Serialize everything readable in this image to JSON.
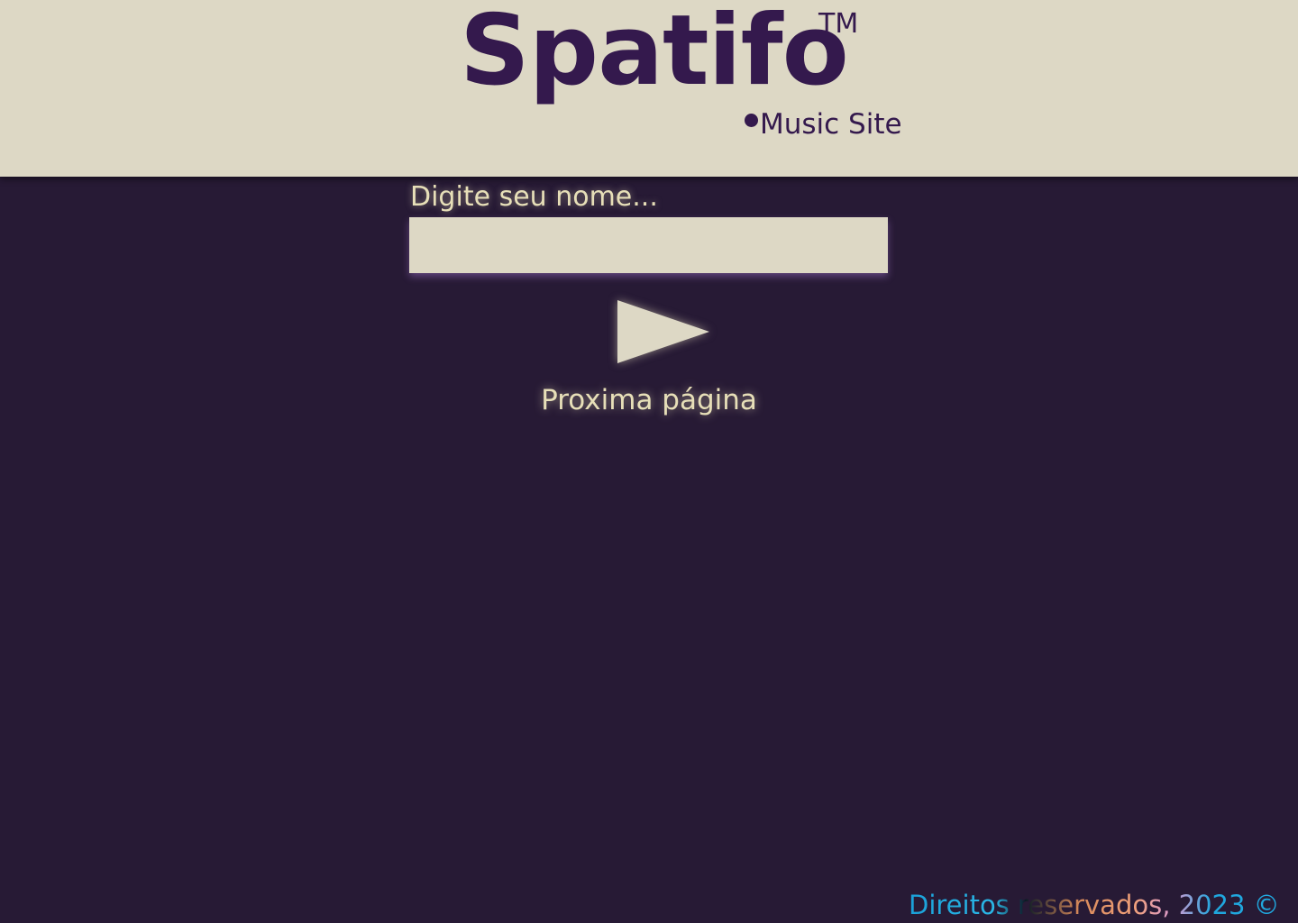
{
  "header": {
    "brand": "Spatifo",
    "trademark": "TM",
    "tagline": "Music Site"
  },
  "form": {
    "name_label": "Digite seu nome...",
    "name_value": "",
    "next_label": "Proxima página",
    "next_icon": "play-triangle-icon"
  },
  "footer": {
    "text": "Direitos reservados, 2023 ©"
  },
  "colors": {
    "background": "#271a35",
    "header": "#ddd8c5",
    "brand": "#34194d",
    "text_light": "#e7dfb8",
    "footer_accent": "#21a9e0"
  }
}
